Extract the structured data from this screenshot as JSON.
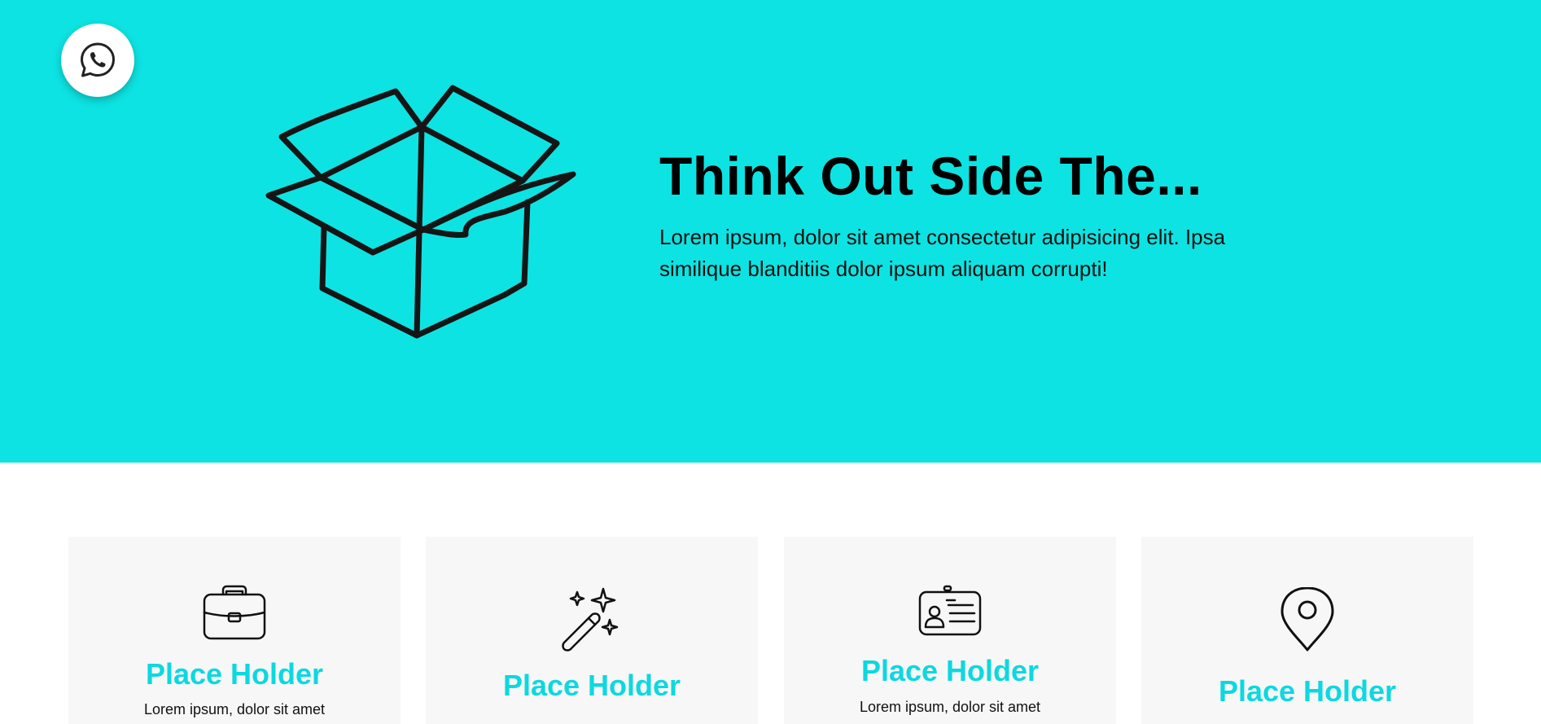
{
  "hero": {
    "title": "Think Out Side The...",
    "text": "Lorem ipsum, dolor sit amet consectetur adipisicing elit. Ipsa similique blanditiis dolor ipsum aliquam corrupti!",
    "background_color": "#0de3e2"
  },
  "floating_button": {
    "icon": "whatsapp-icon"
  },
  "cards": [
    {
      "icon": "briefcase-icon",
      "title": "Place Holder",
      "text": "Lorem ipsum, dolor sit amet"
    },
    {
      "icon": "magic-wand-icon",
      "title": "Place Holder",
      "text": ""
    },
    {
      "icon": "id-card-icon",
      "title": "Place Holder",
      "text": "Lorem ipsum, dolor sit amet"
    },
    {
      "icon": "map-pin-icon",
      "title": "Place Holder",
      "text": ""
    }
  ],
  "colors": {
    "accent": "#0dd8e0",
    "card_background": "#f7f7f7"
  }
}
